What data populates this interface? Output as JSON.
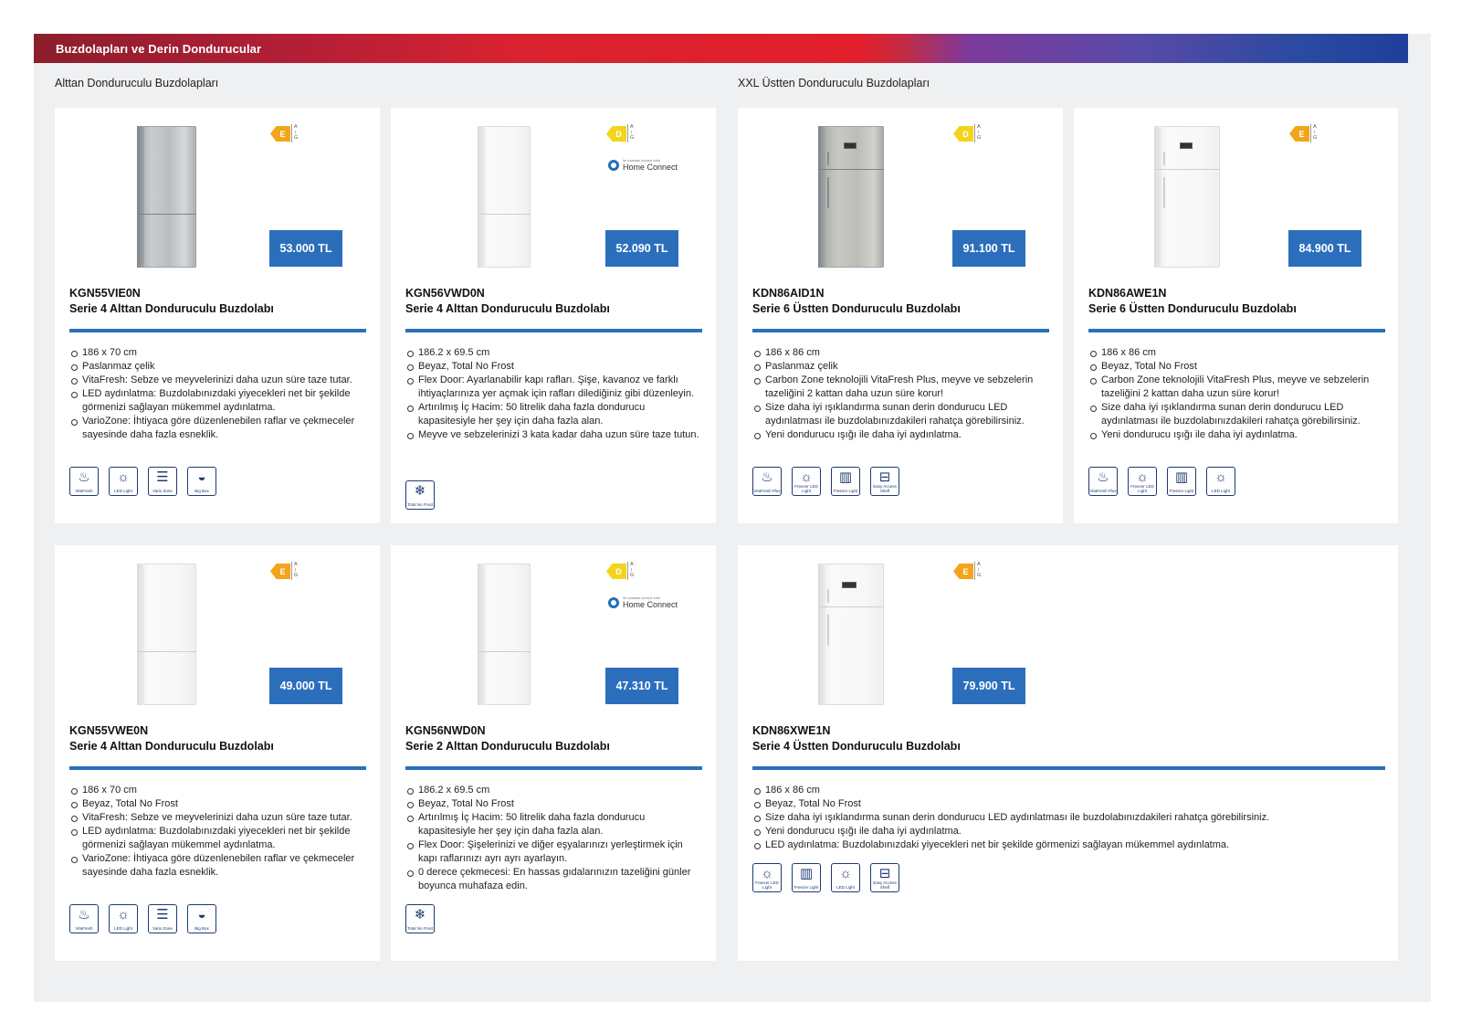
{
  "banner": {
    "title": "Buzdolapları ve Derin Dondurucular"
  },
  "sections": {
    "left": "Alttan Donduruculu Buzdolapları",
    "right": "XXL Üstten Donduruculu Buzdolapları"
  },
  "products": [
    {
      "model": "KGN55VIE0N",
      "subtitle": "Serie 4 Alttan Donduruculu Buzdolabı",
      "price": "53.000 TL",
      "energy_class": "E",
      "energy_scale": [
        "A",
        "↕",
        "G"
      ],
      "finish": "steel",
      "features": [
        "186 x 70 cm",
        "Paslanmaz çelik",
        "VitaFresh: Sebze ve meyvelerinizi daha uzun süre taze tutar.",
        "LED aydınlatma: Buzdolabınızdaki yiyecekleri net bir şekilde görmenizi sağlayan mükemmel aydınlatma.",
        "VarioZone: İhtiyaca göre düzenlenebilen raflar ve çekmeceler sayesinde daha fazla esneklik."
      ],
      "icons": [
        {
          "name": "vitafresh-icon",
          "glyph": "♨",
          "caption": "VitaFresh"
        },
        {
          "name": "led-light-icon",
          "glyph": "☼",
          "caption": "LED Light"
        },
        {
          "name": "vario-zone-icon",
          "glyph": "☰",
          "caption": "Vario Zone"
        },
        {
          "name": "big-box-icon",
          "glyph": "◒",
          "caption": "Big Box"
        }
      ]
    },
    {
      "model": "KGN56VWD0N",
      "subtitle": "Serie 4 Alttan Donduruculu Buzdolabı",
      "price": "52.090 TL",
      "energy_class": "D",
      "energy_scale": [
        "A",
        "↕",
        "G"
      ],
      "finish": "white",
      "home_connect": {
        "small": "ile uzaktan kontrol edin",
        "name": "Home Connect"
      },
      "features": [
        "186.2 x 69.5 cm",
        "Beyaz, Total No Frost",
        "Flex Door: Ayarlanabilir kapı rafları. Şişe, kavanoz ve farklı ihtiyaçlarınıza yer açmak için rafları dilediğiniz gibi düzenleyin.",
        "Artırılmış İç Hacim: 50 litrelik daha fazla dondurucu kapasitesiyle her şey için daha fazla alan.",
        "Meyve ve sebzelerinizi 3 kata kadar daha uzun süre taze tutun."
      ],
      "icons": [
        {
          "name": "total-no-frost-icon",
          "glyph": "❄",
          "caption": "Total No Frost"
        }
      ]
    },
    {
      "model": "KDN86AID1N",
      "subtitle": "Serie 6 Üstten Donduruculu Buzdolabı",
      "price": "91.100 TL",
      "energy_class": "D",
      "energy_scale": [
        "A",
        "↕",
        "G"
      ],
      "finish": "steel-tall",
      "features": [
        "186 x 86 cm",
        "Paslanmaz çelik",
        "Carbon Zone teknolojili VitaFresh Plus, meyve ve sebzelerin tazeliğini 2 kattan daha uzun süre korur!",
        "Size daha iyi ışıklandırma sunan derin dondurucu LED aydınlatması ile buzdolabınızdakileri rahatça görebilirsiniz.",
        "Yeni dondurucu ışığı ile daha iyi aydınlatma."
      ],
      "icons": [
        {
          "name": "vitafresh-plus-icon",
          "glyph": "♨",
          "caption": "VitaFresh Plus"
        },
        {
          "name": "freezer-led-icon",
          "glyph": "☼",
          "caption": "Freezer LED Light"
        },
        {
          "name": "freezer-light-icon",
          "glyph": "▥",
          "caption": "Freezer Light"
        },
        {
          "name": "easy-access-shelf-icon",
          "glyph": "⊟",
          "caption": "Easy Access Shelf"
        }
      ]
    },
    {
      "model": "KDN86AWE1N",
      "subtitle": "Serie 6 Üstten Donduruculu Buzdolabı",
      "price": "84.900 TL",
      "energy_class": "E",
      "energy_scale": [
        "A",
        "↕",
        "G"
      ],
      "finish": "white-tall",
      "features": [
        "186 x 86 cm",
        "Beyaz, Total No Frost",
        "Carbon Zone teknolojili VitaFresh Plus, meyve ve sebzelerin tazeliğini 2 kattan daha uzun süre korur!",
        "Size daha iyi ışıklandırma sunan derin dondurucu LED aydınlatması ile buzdolabınızdakileri rahatça görebilirsiniz.",
        "Yeni dondurucu ışığı ile daha iyi aydınlatma."
      ],
      "icons": [
        {
          "name": "vitafresh-plus-icon",
          "glyph": "♨",
          "caption": "VitaFresh Plus"
        },
        {
          "name": "freezer-led-icon",
          "glyph": "☼",
          "caption": "Freezer LED Light"
        },
        {
          "name": "freezer-light-icon",
          "glyph": "▥",
          "caption": "Freezer Light"
        },
        {
          "name": "led-light-icon",
          "glyph": "☼",
          "caption": "LED Light"
        }
      ]
    },
    {
      "model": "KGN55VWE0N",
      "subtitle": "Serie 4 Alttan Donduruculu Buzdolabı",
      "price": "49.000 TL",
      "energy_class": "E",
      "energy_scale": [
        "A",
        "↕",
        "G"
      ],
      "finish": "white",
      "features": [
        "186 x 70 cm",
        "Beyaz, Total No Frost",
        "VitaFresh: Sebze ve meyvelerinizi daha uzun süre taze tutar.",
        "LED aydınlatma: Buzdolabınızdaki yiyecekleri net bir şekilde görmenizi sağlayan mükemmel aydınlatma.",
        "VarioZone: İhtiyaca göre düzenlenebilen raflar ve çekmeceler sayesinde daha fazla esneklik."
      ],
      "icons": [
        {
          "name": "vitafresh-icon",
          "glyph": "♨",
          "caption": "VitaFresh"
        },
        {
          "name": "led-light-icon",
          "glyph": "☼",
          "caption": "LED Light"
        },
        {
          "name": "vario-zone-icon",
          "glyph": "☰",
          "caption": "Vario Zone"
        },
        {
          "name": "big-box-icon",
          "glyph": "◒",
          "caption": "Big Box"
        }
      ]
    },
    {
      "model": "KGN56NWD0N",
      "subtitle": "Serie 2 Alttan Donduruculu Buzdolabı",
      "price": "47.310 TL",
      "energy_class": "D",
      "energy_scale": [
        "A",
        "↕",
        "G"
      ],
      "finish": "white",
      "home_connect": {
        "small": "ile uzaktan kontrol edin",
        "name": "Home Connect"
      },
      "features": [
        "186.2 x 69.5 cm",
        "Beyaz, Total No Frost",
        "Artırılmış İç Hacim: 50 litrelik daha fazla dondurucu kapasitesiyle her şey için daha fazla alan.",
        "Flex Door: Şişelerinizi ve diğer eşyalarınızı yerleştirmek için kapı raflarınızı ayrı ayrı ayarlayın.",
        "0 derece çekmecesi: En hassas gıdalarınızın tazeliğini günler boyunca muhafaza edin."
      ],
      "icons": [
        {
          "name": "total-no-frost-icon",
          "glyph": "❄",
          "caption": "Total No Frost"
        }
      ]
    },
    {
      "model": "KDN86XWE1N",
      "subtitle": "Serie 4 Üstten Donduruculu Buzdolabı",
      "price": "79.900 TL",
      "energy_class": "E",
      "energy_scale": [
        "A",
        "↕",
        "G"
      ],
      "finish": "white-tall-display",
      "features": [
        "186 x 86 cm",
        "Beyaz, Total No Frost",
        "Size daha iyi ışıklandırma sunan derin dondurucu LED aydınlatması ile buzdolabınızdakileri rahatça görebilirsiniz.",
        "Yeni dondurucu ışığı ile daha iyi aydınlatma.",
        "LED aydınlatma: Buzdolabınızdaki yiyecekleri net bir şekilde görmenizi sağlayan mükemmel aydınlatma."
      ],
      "icons": [
        {
          "name": "freezer-led-icon",
          "glyph": "☼",
          "caption": "Freezer LED Light"
        },
        {
          "name": "freezer-light-icon",
          "glyph": "▥",
          "caption": "Freezer Light"
        },
        {
          "name": "led-light-icon",
          "glyph": "☼",
          "caption": "LED Light"
        },
        {
          "name": "easy-access-shelf-icon",
          "glyph": "⊟",
          "caption": "Easy Access Shelf"
        }
      ]
    }
  ]
}
